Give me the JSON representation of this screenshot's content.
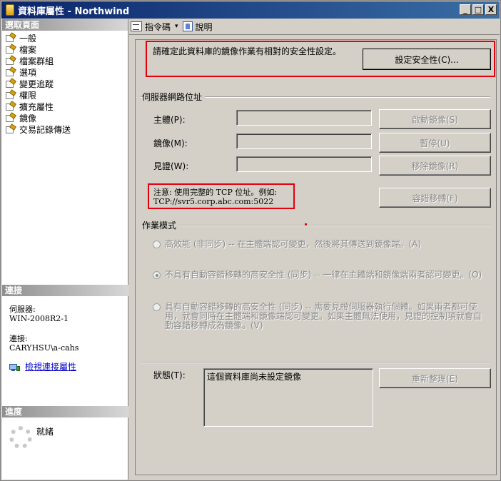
{
  "window": {
    "title": "資料庫屬性 - Northwind",
    "buttons": {
      "minimize": "_",
      "maximize": "□",
      "close": "X"
    }
  },
  "sidebar": {
    "select_page_header": "選取頁面",
    "pages": [
      {
        "label": "一般",
        "icon": "properties-page-icon"
      },
      {
        "label": "檔案",
        "icon": "properties-page-icon"
      },
      {
        "label": "檔案群組",
        "icon": "properties-page-icon"
      },
      {
        "label": "選項",
        "icon": "properties-page-icon"
      },
      {
        "label": "變更追蹤",
        "icon": "properties-page-icon"
      },
      {
        "label": "權限",
        "icon": "properties-page-icon"
      },
      {
        "label": "擴充屬性",
        "icon": "properties-page-icon"
      },
      {
        "label": "鏡像",
        "icon": "properties-page-icon"
      },
      {
        "label": "交易記錄傳送",
        "icon": "properties-page-icon"
      }
    ],
    "connection": {
      "header": "連接",
      "server_label": "伺服器:",
      "server_value": "WIN-2008R2-1",
      "connection_label": "連接:",
      "connection_value": "CARYHSU\\a-cahs",
      "view_link": "檢視連接屬性"
    },
    "progress": {
      "header": "進度",
      "status": "就緒"
    }
  },
  "toolbar": {
    "script_label": "指令碼",
    "script_arrow": "▾",
    "help_label": "說明"
  },
  "security": {
    "message": "請確定此資料庫的鏡像作業有相對的安全性設定。",
    "configure_button": "設定安全性(C)..."
  },
  "server_addresses": {
    "group_title": "伺服器網路位址",
    "principal_label": "主體(P):",
    "principal_value": "",
    "mirror_label": "鏡像(M):",
    "mirror_value": "",
    "witness_label": "見證(W):",
    "witness_value": "",
    "start_mirroring_button": "啟動鏡像(S)",
    "pause_button": "暫停(U)",
    "remove_mirroring_button": "移除鏡像(R)",
    "failover_button": "容錯移轉(F)",
    "note_line1": "注意: 使用完整的 TCP 位址。例如:",
    "note_line2": "TCP://svr5.corp.abc.com:5022"
  },
  "operating_mode": {
    "group_title": "作業模式",
    "options": [
      {
        "label": "高效能 (非同步) -- 在主體端認可變更，然後將其傳送到鏡像端。(A)",
        "checked": false
      },
      {
        "label": "不具有自動容錯移轉的高安全性 (同步) -- 一律在主體端和鏡像端兩者認可變更。(O)",
        "checked": true
      },
      {
        "label_lines": [
          "具有自動容錯移轉的高安全性 (同步) -- 需要見證伺服器執行個體。如果兩者都可使",
          "用，就會同時在主體端和鏡像端認可變更。如果主體無法使用，見證的控制項就會自",
          "動容錯移轉成為鏡像。(V)"
        ],
        "checked": false
      }
    ]
  },
  "status": {
    "label": "狀態(T):",
    "value": "這個資料庫尚未設定鏡像",
    "refresh_button": "重新整理(E)"
  },
  "colors": {
    "highlight_box": "#e3000f",
    "titlebar_start": "#0a246a",
    "titlebar_end": "#3a6ea5",
    "dialog_background": "#d4d0c8",
    "link": "#0000cc"
  }
}
